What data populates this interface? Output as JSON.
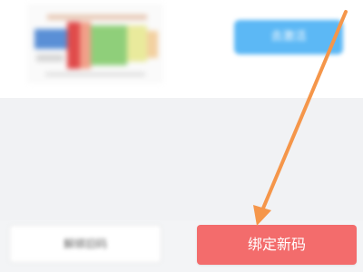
{
  "top_card": {
    "action_button_label": "去激活",
    "action_button_color": "#5cb8f5"
  },
  "bottom_bar": {
    "secondary_button_label": "解绑旧码",
    "primary_button_label": "绑定新码",
    "primary_button_color": "#f36c6c"
  },
  "annotation": {
    "arrow_color": "#f5964a"
  }
}
